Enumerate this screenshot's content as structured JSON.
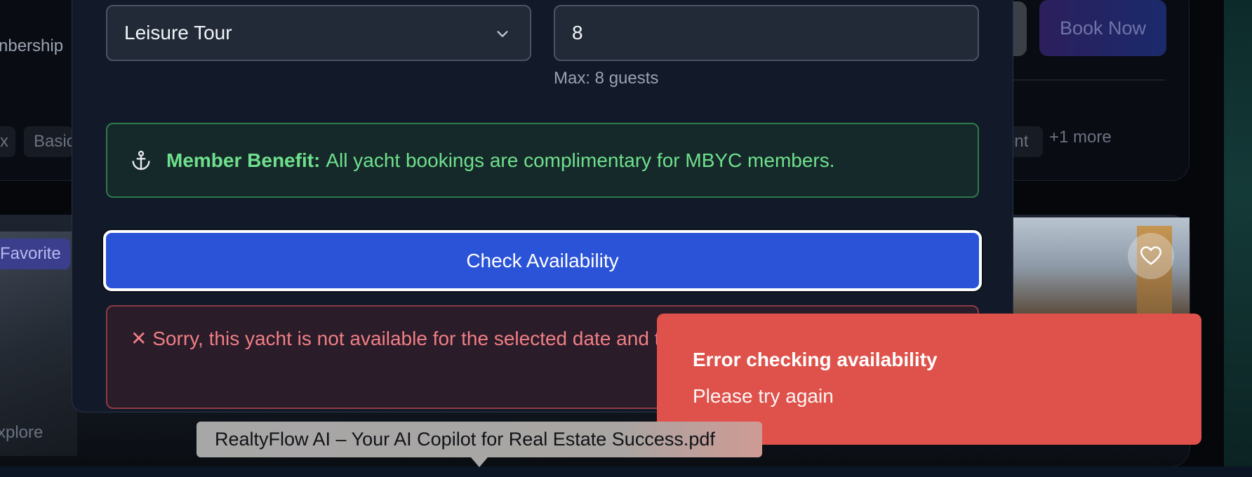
{
  "background": {
    "membership_fragment": "nbership",
    "chips": [
      "x",
      "Basic",
      "ent"
    ],
    "more_label": "+1 more",
    "book_now_label": "Book Now",
    "favorite_label": "Favorite",
    "explore_label": "xplore"
  },
  "form": {
    "tour_type": {
      "selected": "Leisure Tour"
    },
    "guests": {
      "value": "8",
      "hint": "Max: 8 guests"
    }
  },
  "benefit": {
    "label": "Member Benefit:",
    "text": "All yacht bookings are complimentary for MBYC members."
  },
  "check_button_label": "Check Availability",
  "availability_error": "✕ Sorry, this yacht is not available for the selected date and time slot.",
  "toast": {
    "title": "Error checking availability",
    "description": "Please try again"
  },
  "tooltip_text": "RealtyFlow AI – Your AI Copilot for Real Estate Success.pdf",
  "colors": {
    "primary_button": "#2b53d8",
    "toast_bg": "#df524b",
    "benefit_text": "#6ee08c",
    "error_text": "#f07f84"
  },
  "icons": [
    "chevron-down-icon",
    "anchor-icon",
    "heart-icon"
  ]
}
